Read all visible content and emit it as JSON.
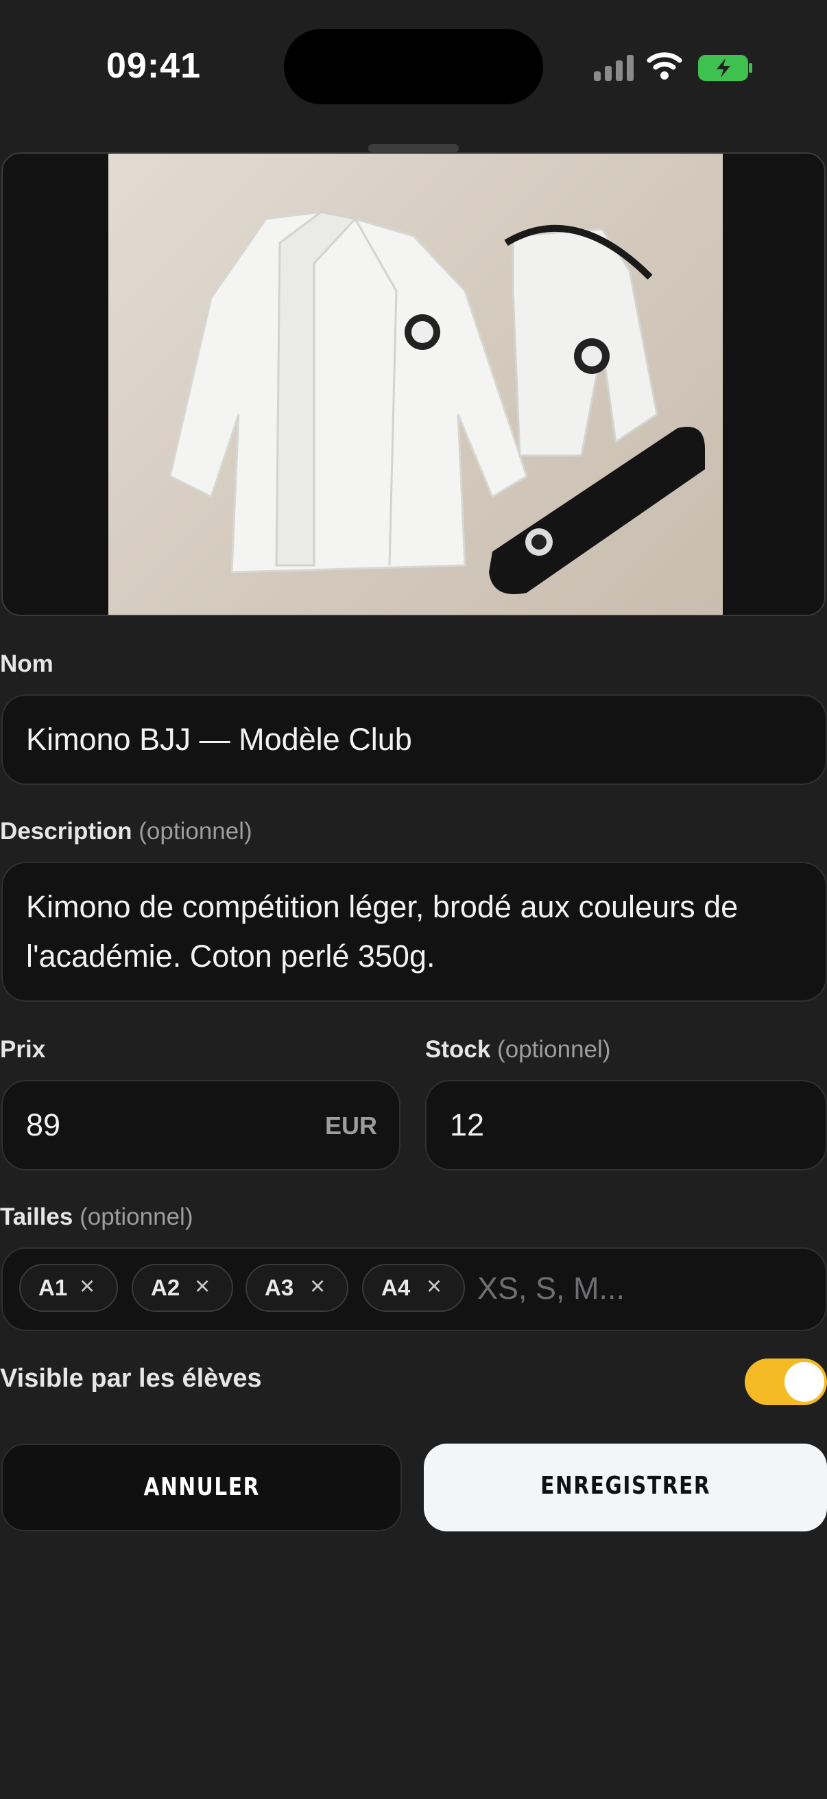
{
  "status_bar": {
    "time": "09:41"
  },
  "form": {
    "name": {
      "label": "Nom",
      "value": "Kimono BJJ — Modèle Club"
    },
    "description": {
      "label": "Description",
      "optional": "(optionnel)",
      "value_line1": "Kimono de compétition léger, brodé aux couleurs de",
      "value_line2": "l'académie. Coton perlé 350g."
    },
    "price": {
      "label": "Prix",
      "value": "89",
      "currency": "EUR"
    },
    "stock": {
      "label": "Stock",
      "optional": "(optionnel)",
      "value": "12"
    },
    "sizes": {
      "label": "Tailles",
      "optional": "(optionnel)",
      "chips": [
        "A1",
        "A2",
        "A3",
        "A4"
      ],
      "placeholder": "XS, S, M..."
    },
    "visible": {
      "label": "Visible par les élèves",
      "enabled": true
    }
  },
  "actions": {
    "cancel": "ANNULER",
    "save": "ENREGISTRER"
  },
  "colors": {
    "accent": "#f5bb24",
    "background": "#1f1f20",
    "field": "#121213"
  },
  "icons": [
    "cellular-signal-icon",
    "wifi-icon",
    "battery-charging-icon",
    "chip-remove-icon"
  ]
}
